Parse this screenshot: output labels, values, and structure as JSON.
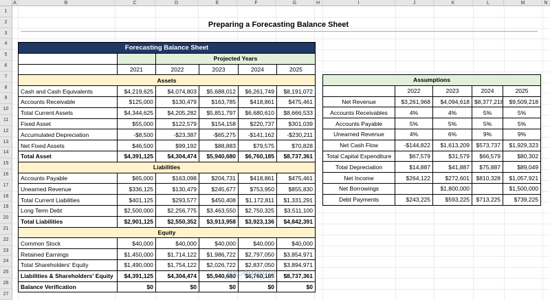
{
  "columns": [
    "A",
    "B",
    "C",
    "D",
    "E",
    "F",
    "G",
    "H",
    "I",
    "J",
    "K",
    "L",
    "M",
    "N"
  ],
  "rows": [
    "1",
    "2",
    "3",
    "4",
    "5",
    "6",
    "7",
    "8",
    "9",
    "10",
    "11",
    "12",
    "13",
    "14",
    "15",
    "16",
    "17",
    "18",
    "19",
    "20",
    "21",
    "22",
    "23",
    "24",
    "25",
    "26",
    "27"
  ],
  "title": "Preparing a Forecasting Balance Sheet",
  "balance": {
    "header": "Forecasting Balance Sheet",
    "projected_label": "Projected Years",
    "years": [
      "2021",
      "2022",
      "2023",
      "2024",
      "2025"
    ],
    "sections": [
      {
        "name": "Assets",
        "rows": [
          {
            "label": "Cash and Cash Equivalents",
            "values": [
              "$4,219,625",
              "$4,074,803",
              "$5,688,012",
              "$6,261,749",
              "$8,191,072"
            ],
            "bold": false
          },
          {
            "label": "Accounts Receivable",
            "values": [
              "$125,000",
              "$130,479",
              "$163,785",
              "$418,861",
              "$475,461"
            ],
            "bold": false
          },
          {
            "label": "Total Current Assets",
            "values": [
              "$4,344,625",
              "$4,205,282",
              "$5,851,797",
              "$6,680,610",
              "$8,666,533"
            ],
            "bold": false
          },
          {
            "label": "Fixed Asset",
            "values": [
              "$55,000",
              "$122,579",
              "$154,158",
              "$220,737",
              "$301,039"
            ],
            "bold": false
          },
          {
            "label": "Accumulated Depreciation",
            "values": [
              "-$8,500",
              "-$23,387",
              "-$65,275",
              "-$141,162",
              "-$230,211"
            ],
            "bold": false
          },
          {
            "label": "Net Fixed Assets",
            "values": [
              "$46,500",
              "$99,192",
              "$88,883",
              "$79,575",
              "$70,828"
            ],
            "bold": false
          },
          {
            "label": "Total Asset",
            "values": [
              "$4,391,125",
              "$4,304,474",
              "$5,940,680",
              "$6,760,185",
              "$8,737,361"
            ],
            "bold": true
          }
        ]
      },
      {
        "name": "Liabilities",
        "rows": [
          {
            "label": "Accounts Payable",
            "values": [
              "$65,000",
              "$163,098",
              "$204,731",
              "$418,861",
              "$475,461"
            ],
            "bold": false
          },
          {
            "label": "Unearned Revenue",
            "values": [
              "$336,125",
              "$130,479",
              "$245,677",
              "$753,950",
              "$855,830"
            ],
            "bold": false
          },
          {
            "label": "Total Current Liabilities",
            "values": [
              "$401,125",
              "$293,577",
              "$450,408",
              "$1,172,811",
              "$1,331,291"
            ],
            "bold": false
          },
          {
            "label": "Long Term Debt",
            "values": [
              "$2,500,000",
              "$2,256,775",
              "$3,463,550",
              "$2,750,325",
              "$3,511,100"
            ],
            "bold": false
          },
          {
            "label": "Total Liabilities",
            "values": [
              "$2,901,125",
              "$2,550,352",
              "$3,913,958",
              "$3,923,136",
              "$4,842,391"
            ],
            "bold": true
          }
        ]
      },
      {
        "name": "Equity",
        "rows": [
          {
            "label": "Common Stock",
            "values": [
              "$40,000",
              "$40,000",
              "$40,000",
              "$40,000",
              "$40,000"
            ],
            "bold": false
          },
          {
            "label": "Retained Earnings",
            "values": [
              "$1,450,000",
              "$1,714,122",
              "$1,986,722",
              "$2,797,050",
              "$3,854,971"
            ],
            "bold": false
          },
          {
            "label": "Total Shareholders' Equity",
            "values": [
              "$1,490,000",
              "$1,754,122",
              "$2,026,722",
              "$2,837,050",
              "$3,894,971"
            ],
            "bold": false
          },
          {
            "label": "Liabilities & Shareholders' Equity",
            "values": [
              "$4,391,125",
              "$4,304,474",
              "$5,940,680",
              "$6,760,185",
              "$8,737,361"
            ],
            "bold": true
          },
          {
            "label": "Balance Verification",
            "values": [
              "$0",
              "$0",
              "$0",
              "$0",
              "$0"
            ],
            "bold": true
          }
        ]
      }
    ]
  },
  "assumptions": {
    "header": "Assumptions",
    "years": [
      "2022",
      "2023",
      "2024",
      "2025"
    ],
    "rows": [
      {
        "label": "Net Revenue",
        "values": [
          "$3,261,968",
          "$4,094,618",
          "$8,377,218",
          "$9,509,218"
        ]
      },
      {
        "label": "Accounts Receivables",
        "values": [
          "4%",
          "4%",
          "5%",
          "5%"
        ]
      },
      {
        "label": "Accounts Payable",
        "values": [
          "5%",
          "5%",
          "5%",
          "5%"
        ]
      },
      {
        "label": "Unearned Revenue",
        "values": [
          "4%",
          "6%",
          "9%",
          "9%"
        ]
      },
      {
        "label": "Net Cash Flow",
        "values": [
          "-$144,822",
          "$1,613,209",
          "$573,737",
          "$1,929,323"
        ]
      },
      {
        "label": "Total Capital Expenditure",
        "values": [
          "$67,579",
          "$31,579",
          "$66,579",
          "$80,302"
        ]
      },
      {
        "label": "Total Depreciation",
        "values": [
          "$14,887",
          "$41,887",
          "$75,887",
          "$89,049"
        ]
      },
      {
        "label": "Net Income",
        "values": [
          "$264,122",
          "$272,601",
          "$810,328",
          "$1,057,921"
        ]
      },
      {
        "label": "Net Borrowings",
        "values": [
          "",
          "$1,800,000",
          "",
          "$1,500,000"
        ]
      },
      {
        "label": "Debt Payments",
        "values": [
          "$243,225",
          "$593,225",
          "$713,225",
          "$739,225"
        ]
      }
    ]
  },
  "watermark": {
    "name": "exceldemy",
    "tagline": "EXCEL · DATA · BI"
  }
}
